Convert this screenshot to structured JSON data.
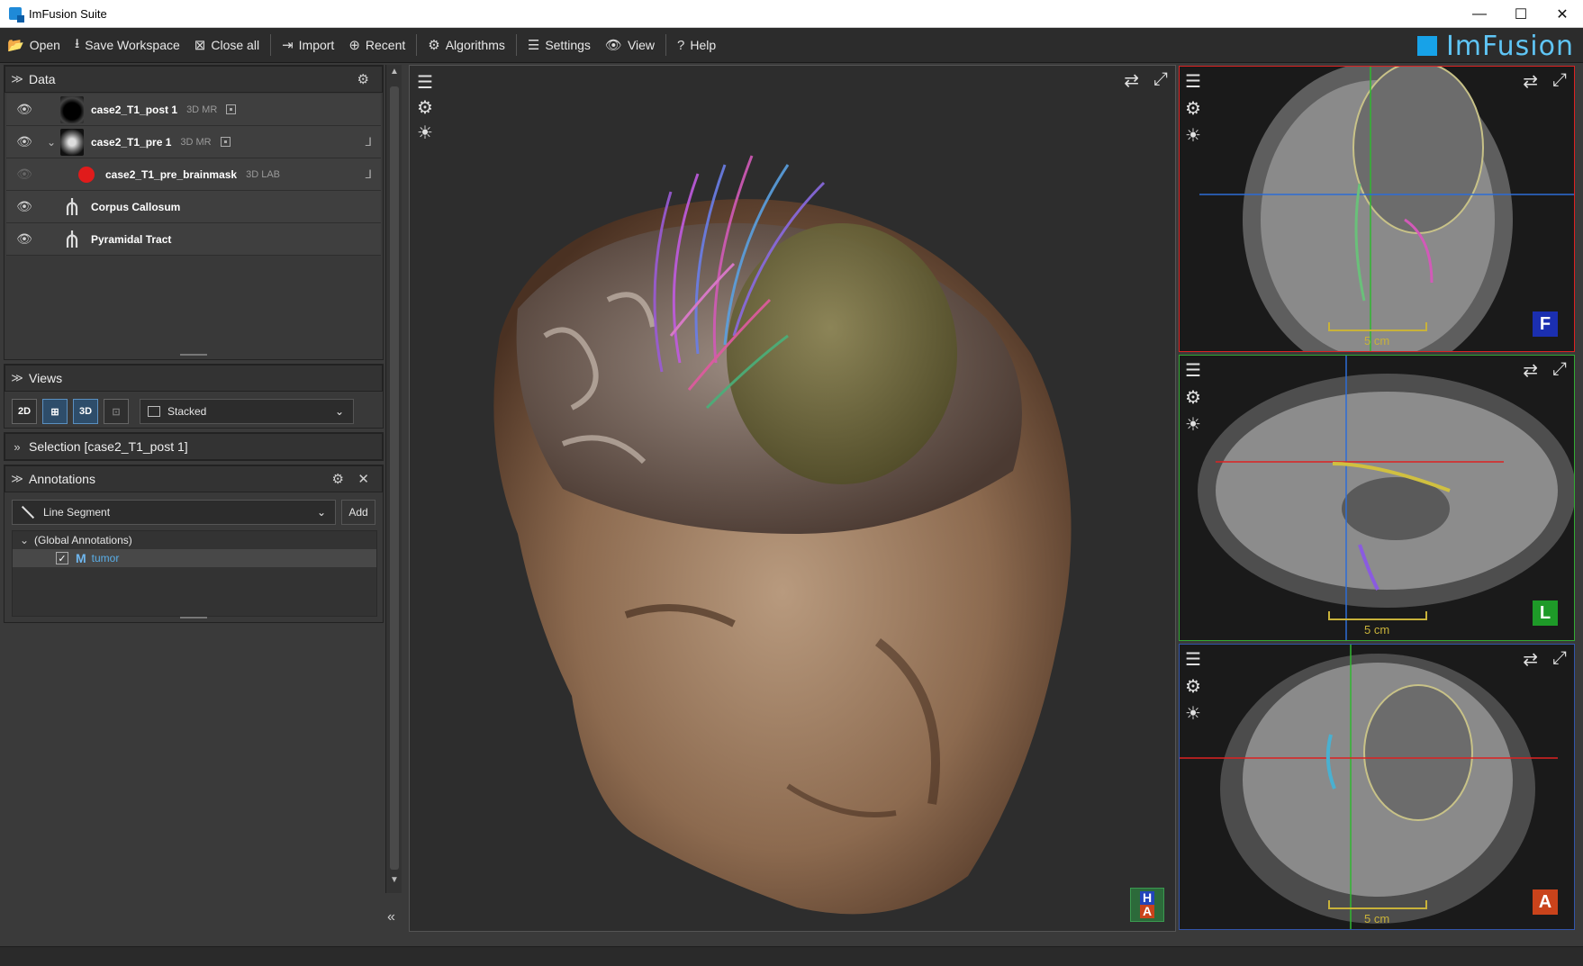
{
  "window": {
    "title": "ImFusion Suite",
    "controls": [
      "—",
      "☐",
      "✕"
    ]
  },
  "toolbar": {
    "items": [
      {
        "icon": "📂",
        "label": "Open"
      },
      {
        "icon": "⭳",
        "label": "Save Workspace"
      },
      {
        "icon": "⊠",
        "label": "Close all"
      },
      {
        "icon": "⇥",
        "label": "Import"
      },
      {
        "icon": "⊕",
        "label": "Recent"
      },
      {
        "icon": "⚙",
        "label": "Algorithms"
      },
      {
        "icon": "☰",
        "label": "Settings"
      },
      {
        "icon": "👁",
        "label": "View"
      },
      {
        "icon": "?",
        "label": "Help"
      }
    ],
    "logo_text": "ImFusion"
  },
  "data_panel": {
    "title": "Data",
    "items": [
      {
        "name": "case2_T1_post 1",
        "tag": "3D MR"
      },
      {
        "name": "case2_T1_pre 1",
        "tag": "3D MR"
      },
      {
        "name": "case2_T1_pre_brainmask",
        "tag": "3D LAB"
      },
      {
        "name": "Corpus Callosum",
        "tag": ""
      },
      {
        "name": "Pyramidal Tract",
        "tag": ""
      }
    ]
  },
  "views_panel": {
    "title": "Views",
    "buttons": [
      "2D",
      "⊞",
      "3D",
      "⊡"
    ],
    "layout_value": "Stacked"
  },
  "selection_panel": {
    "title": "Selection [case2_T1_post 1]"
  },
  "annotations_panel": {
    "title": "Annotations",
    "type_value": "Line Segment",
    "add_label": "Add",
    "group_label": "(Global Annotations)",
    "item_label": "tumor"
  },
  "slices": {
    "scale_label": "5 cm",
    "orientations": [
      "F",
      "L",
      "A"
    ]
  },
  "view3d": {
    "cube_labels": [
      "H",
      "A"
    ]
  },
  "colors": {
    "accent": "#17a2e8",
    "red": "#dd2222",
    "green": "#2aa42a",
    "blue": "#3355aa"
  }
}
